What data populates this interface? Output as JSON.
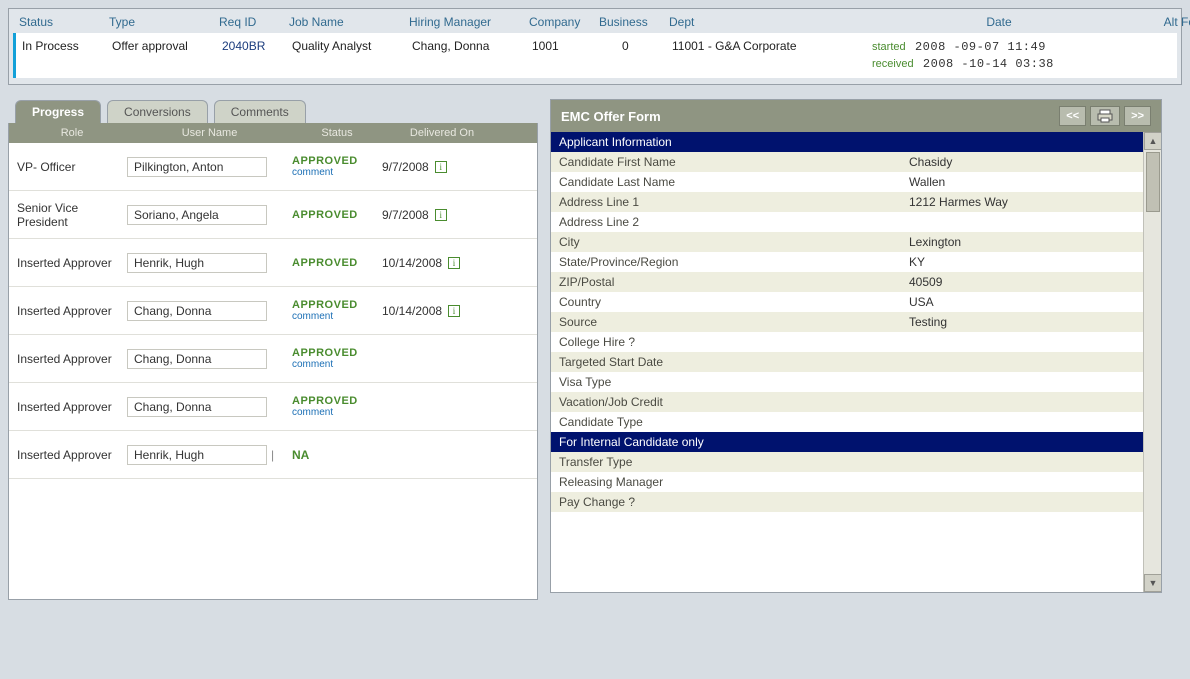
{
  "top": {
    "headers": {
      "status": "Status",
      "type": "Type",
      "reqid": "Req ID",
      "jobname": "Job Name",
      "hm": "Hiring Manager",
      "company": "Company",
      "business": "Business",
      "dept": "Dept",
      "date": "Date",
      "altfor": "Alt For"
    },
    "row": {
      "status": "In Process",
      "type": "Offer approval",
      "reqid": "2040BR",
      "jobname": "Quality Analyst",
      "hm": "Chang, Donna",
      "company": "1001",
      "business": "0",
      "dept": "11001 - G&A Corporate",
      "started_label": "started",
      "started_val": "2008 -09-07 11:49",
      "received_label": "received",
      "received_val": "2008 -10-14 03:38"
    }
  },
  "tabs": {
    "progress": "Progress",
    "conversions": "Conversions",
    "comments": "Comments"
  },
  "progress": {
    "headers": {
      "role": "Role",
      "user": "User Name",
      "status": "Status",
      "delivered": "Delivered On"
    },
    "comment": "comment",
    "info": "i",
    "rows": [
      {
        "role": "VP- Officer",
        "user": "Pilkington, Anton",
        "status": "APPROVED",
        "has_comment": true,
        "delivered": "9/7/2008",
        "has_info": true,
        "bar": false
      },
      {
        "role": "Senior Vice President",
        "user": "Soriano, Angela",
        "status": "APPROVED",
        "has_comment": false,
        "delivered": "9/7/2008",
        "has_info": true,
        "bar": false
      },
      {
        "role": "Inserted Approver",
        "user": "Henrik, Hugh",
        "status": "APPROVED",
        "has_comment": false,
        "delivered": "10/14/2008",
        "has_info": true,
        "bar": false
      },
      {
        "role": "Inserted Approver",
        "user": "Chang, Donna",
        "status": "APPROVED",
        "has_comment": true,
        "delivered": "10/14/2008",
        "has_info": true,
        "bar": false
      },
      {
        "role": "Inserted Approver",
        "user": "Chang, Donna",
        "status": "APPROVED",
        "has_comment": true,
        "delivered": "",
        "has_info": false,
        "bar": false
      },
      {
        "role": "Inserted Approver",
        "user": "Chang, Donna",
        "status": "APPROVED",
        "has_comment": true,
        "delivered": "",
        "has_info": false,
        "bar": false
      },
      {
        "role": "Inserted Approver",
        "user": "Henrik, Hugh",
        "status": "NA",
        "has_comment": false,
        "delivered": "",
        "has_info": false,
        "bar": true
      }
    ]
  },
  "form": {
    "title": "EMC Offer Form",
    "sections": [
      {
        "heading": "Applicant Information",
        "rows": [
          {
            "label": "Candidate First Name",
            "value": "Chasidy"
          },
          {
            "label": "Candidate Last Name",
            "value": "Wallen"
          },
          {
            "label": "Address Line 1",
            "value": "1212 Harmes Way"
          },
          {
            "label": "Address Line 2",
            "value": ""
          },
          {
            "label": "City",
            "value": "Lexington"
          },
          {
            "label": "State/Province/Region",
            "value": "KY"
          },
          {
            "label": "ZIP/Postal",
            "value": "40509"
          },
          {
            "label": "Country",
            "value": "USA"
          },
          {
            "label": "Source",
            "value": "Testing"
          },
          {
            "label": "College Hire ?",
            "value": ""
          },
          {
            "label": "Targeted Start Date",
            "value": ""
          },
          {
            "label": "Visa Type",
            "value": ""
          },
          {
            "label": "Vacation/Job Credit",
            "value": ""
          },
          {
            "label": "Candidate Type",
            "value": ""
          }
        ]
      },
      {
        "heading": "For Internal Candidate only",
        "rows": [
          {
            "label": "Transfer Type",
            "value": ""
          },
          {
            "label": "Releasing Manager",
            "value": ""
          },
          {
            "label": "Pay Change ?",
            "value": ""
          }
        ]
      }
    ],
    "nav": {
      "prev": "<<",
      "next": ">>"
    }
  }
}
